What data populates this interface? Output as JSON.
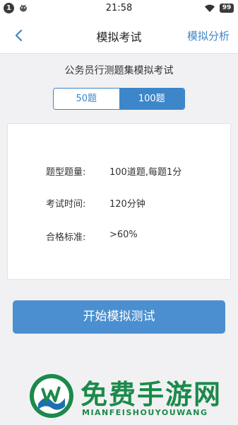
{
  "status_bar": {
    "notification_count": "1",
    "time": "21:58",
    "battery": "99",
    "icons": [
      "notification-badge",
      "android-robot-icon",
      "wifi-icon",
      "battery-icon"
    ]
  },
  "navbar": {
    "title": "模拟考试",
    "action_label": "模拟分析",
    "back_icon": "chevron-left-icon",
    "accent_color": "#3d86c9"
  },
  "exam": {
    "title": "公务员行测题集模拟考试",
    "tabs": [
      {
        "label": "50题",
        "selected": false
      },
      {
        "label": "100题",
        "selected": true
      }
    ]
  },
  "info": {
    "rows": [
      {
        "label": "题型题量:",
        "value": "100道题,每题1分"
      },
      {
        "label": "考试时间:",
        "value": "120分钟"
      },
      {
        "label": "合格标准:",
        "value": ">60%"
      }
    ]
  },
  "start_button": {
    "label": "开始模拟测试",
    "color": "#4b8fd0"
  },
  "watermark": {
    "title": "免费手游网",
    "subtitle": "MIANFEISHOUYOUWANG",
    "color": "#1b8a4a"
  }
}
